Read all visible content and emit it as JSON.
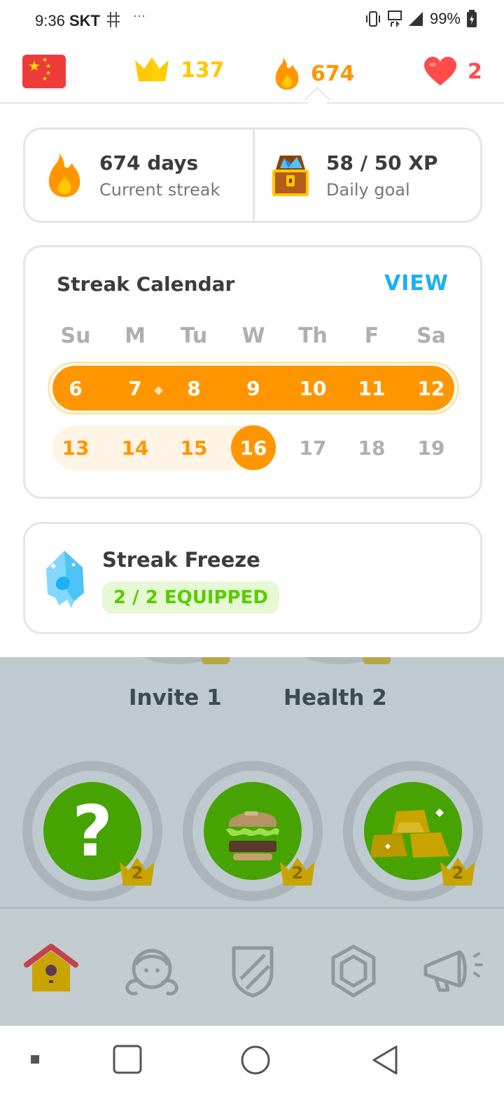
{
  "status_bar": {
    "time": "9:36",
    "carrier": "SKT",
    "more": "···",
    "battery": "99%"
  },
  "top_bar": {
    "language_flag": "china-flag",
    "crowns": "137",
    "streak": "674",
    "hearts": "2"
  },
  "summary": {
    "streak_value": "674 days",
    "streak_label": "Current streak",
    "goal_value": "58 / 50 XP",
    "goal_label": "Daily goal"
  },
  "calendar": {
    "title": "Streak Calendar",
    "view_label": "VIEW",
    "weekdays": [
      "Su",
      "M",
      "Tu",
      "W",
      "Th",
      "F",
      "Sa"
    ],
    "week1": [
      "6",
      "7",
      "8",
      "9",
      "10",
      "11",
      "12"
    ],
    "week2": [
      "13",
      "14",
      "15",
      "16",
      "17",
      "18",
      "19"
    ],
    "today": "16"
  },
  "freeze": {
    "title": "Streak Freeze",
    "badge": "2 / 2 EQUIPPED"
  },
  "skills": {
    "upper_labels": [
      "Invite 1",
      "Health 2"
    ],
    "items": [
      {
        "icon": "question-icon",
        "level": "2"
      },
      {
        "icon": "burger-icon",
        "level": "2"
      },
      {
        "icon": "gold-bars-icon",
        "level": "2"
      }
    ]
  },
  "nav": [
    "home-icon",
    "profile-icon",
    "leagues-icon",
    "shop-icon",
    "news-icon"
  ],
  "colors": {
    "orange": "#ff9600",
    "gold": "#ffc800",
    "red": "#ff4b4b",
    "blue": "#1cb0f6",
    "green": "#58cc02"
  }
}
